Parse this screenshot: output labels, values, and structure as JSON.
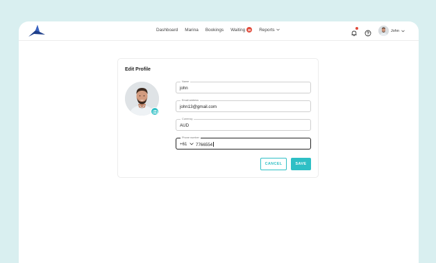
{
  "header": {
    "nav": [
      {
        "label": "Dashboard"
      },
      {
        "label": "Marina"
      },
      {
        "label": "Bookings"
      },
      {
        "label": "Waiting",
        "badge": "30"
      },
      {
        "label": "Reports"
      }
    ],
    "user_name": "John"
  },
  "edit_profile": {
    "title": "Edit Profile",
    "fields": {
      "name": {
        "label": "Name",
        "value": "john"
      },
      "email": {
        "label": "Email address",
        "value": "john13@gmail.com"
      },
      "currency": {
        "label": "Currency",
        "value": "AUD"
      },
      "phone": {
        "label": "Phone number",
        "code": "+61",
        "value": "7766554"
      }
    },
    "buttons": {
      "cancel": "CANCEL",
      "save": "SAVE"
    }
  },
  "colors": {
    "background": "#d9eff0",
    "accent": "#2ebfc5",
    "badge": "#e04a3a",
    "logo": "#1f3f8a"
  }
}
